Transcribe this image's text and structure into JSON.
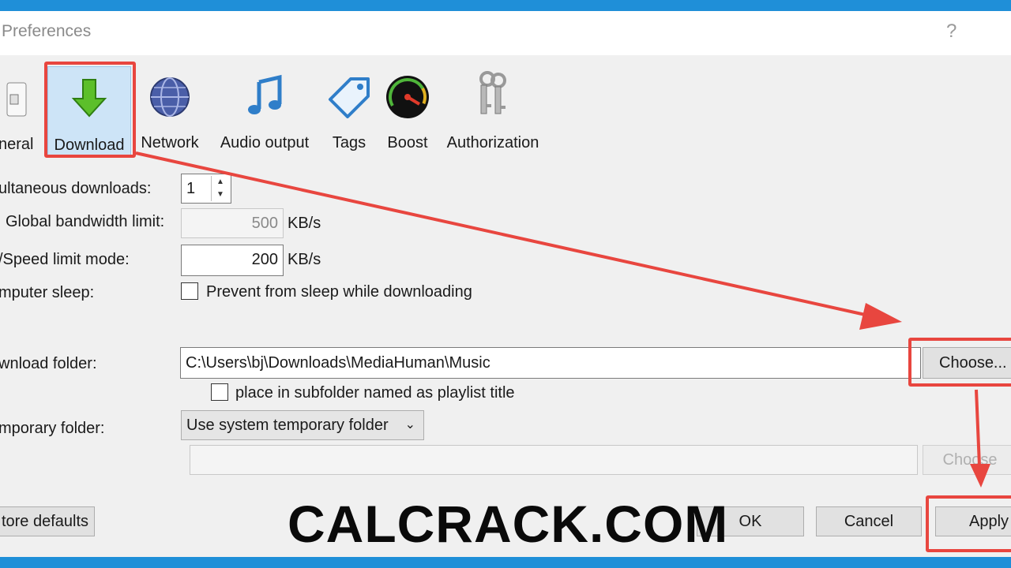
{
  "window": {
    "title": "Preferences",
    "help": "?"
  },
  "toolbar": {
    "items": [
      {
        "label": "neral",
        "icon": "general-icon"
      },
      {
        "label": "Download",
        "icon": "download-arrow-icon",
        "selected": true
      },
      {
        "label": "Network",
        "icon": "globe-icon"
      },
      {
        "label": "Audio output",
        "icon": "music-note-icon"
      },
      {
        "label": "Tags",
        "icon": "tag-icon"
      },
      {
        "label": "Boost",
        "icon": "speedometer-icon"
      },
      {
        "label": "Authorization",
        "icon": "keys-icon"
      }
    ]
  },
  "settings": {
    "simultaneous_label": "ultaneous downloads:",
    "simultaneous_value": "1",
    "bandwidth_label": "Global bandwidth limit:",
    "bandwidth_value": "500",
    "bandwidth_unit": "KB/s",
    "speed_label": "/Speed limit mode:",
    "speed_value": "200",
    "speed_unit": "KB/s",
    "sleep_label": "mputer sleep:",
    "sleep_checkbox_label": "Prevent from sleep while downloading",
    "folder_label": "wnload folder:",
    "folder_value": "C:\\Users\\bj\\Downloads\\MediaHuman\\Music",
    "choose_label": "Choose...",
    "subfolder_label": "place in subfolder named as playlist title",
    "temp_label": "mporary folder:",
    "temp_select": "Use system temporary folder",
    "temp_choose_label": "Choose"
  },
  "footer": {
    "restore_label": "tore defaults",
    "ok_label": "OK",
    "cancel_label": "Cancel",
    "apply_label": "Apply"
  },
  "watermark": "CALCRACK.COM",
  "colors": {
    "highlight": "#e8463f",
    "selected_tab": "#cde4f7",
    "desktop": "#1f8fd8"
  }
}
